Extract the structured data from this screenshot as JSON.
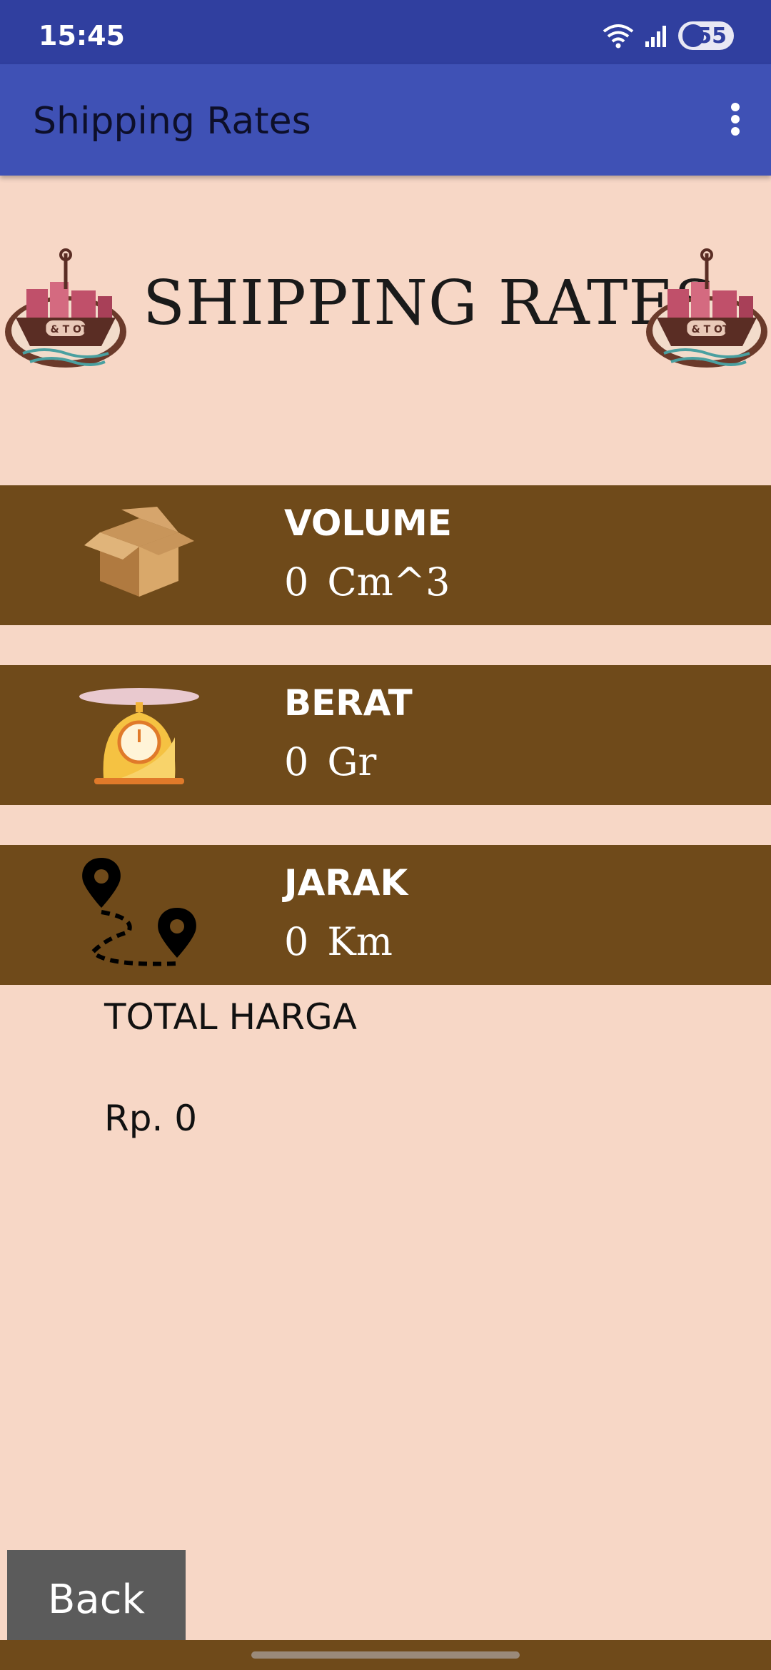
{
  "status_bar": {
    "time": "15:45",
    "battery": "55"
  },
  "app_bar": {
    "title": "Shipping Rates",
    "menu_icon": "more-vert-icon"
  },
  "header": {
    "title": "SHIPPING RATES",
    "logo_text": "J & T OT"
  },
  "rows": [
    {
      "label": "VOLUME",
      "value": "0",
      "unit": "Cm^3",
      "icon": "box-icon"
    },
    {
      "label": "BERAT",
      "value": "0",
      "unit": "Gr",
      "icon": "scale-icon"
    },
    {
      "label": "JARAK",
      "value": "0",
      "unit": "Km",
      "icon": "route-pin-icon"
    }
  ],
  "total": {
    "label": "TOTAL HARGA",
    "value": "Rp. 0"
  },
  "back_button": {
    "label": "Back"
  },
  "colors": {
    "status_bar": "#303f9f",
    "app_bar": "#3f51b5",
    "background": "#f7d7c6",
    "band": "#6f4a1a",
    "button": "#5b5b5b"
  }
}
